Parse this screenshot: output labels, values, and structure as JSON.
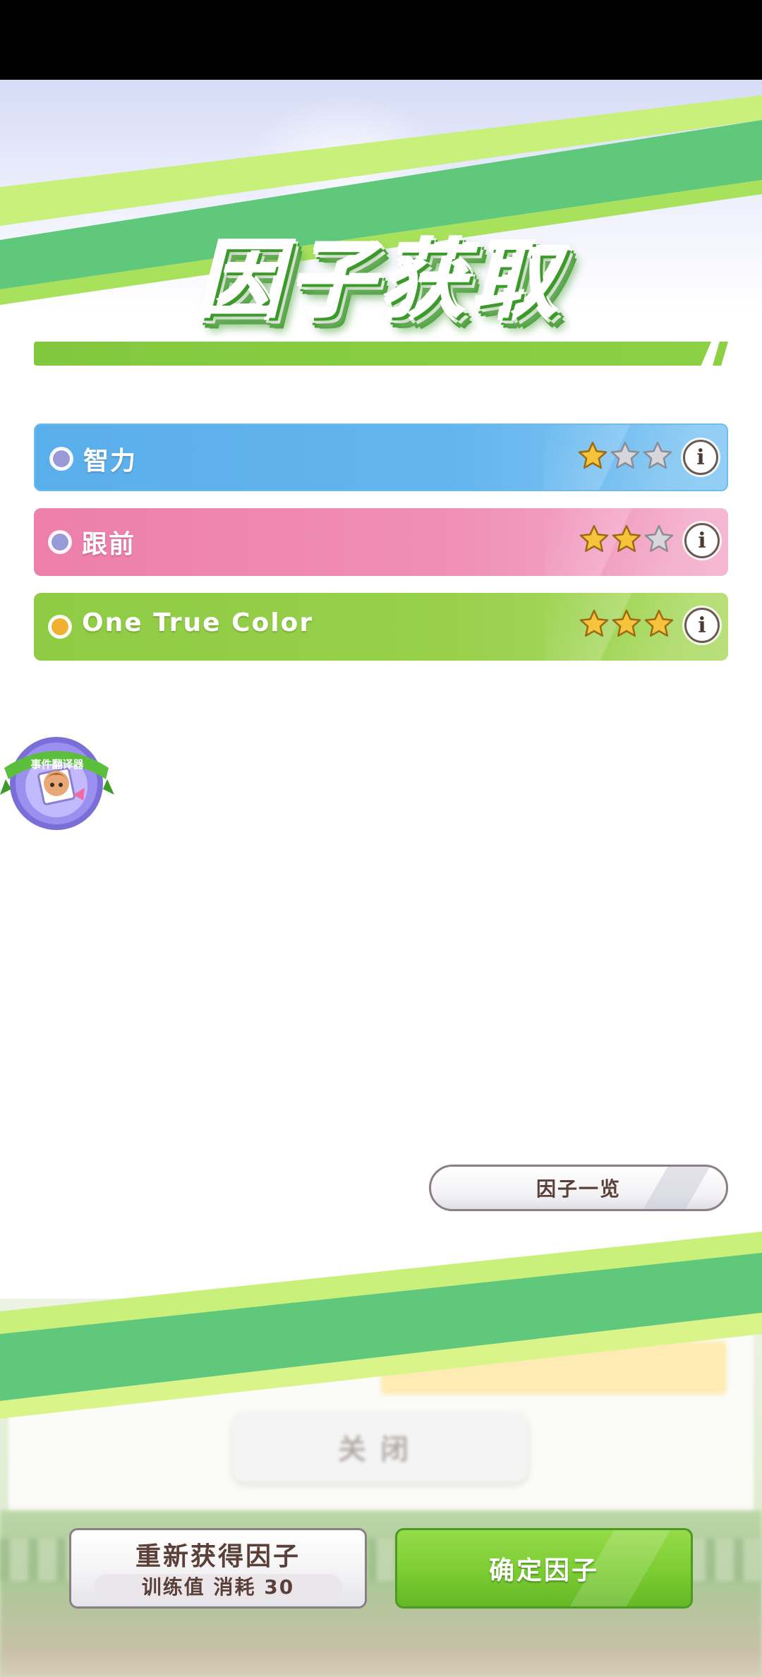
{
  "title": "因子获取",
  "factors": [
    {
      "name": "智力",
      "stars": 1,
      "max_stars": 3,
      "color": "#5aaeea",
      "dot_color": "#9a9ad8"
    },
    {
      "name": "跟前",
      "stars": 2,
      "max_stars": 3,
      "color": "#ee7eac",
      "dot_color": "#9a9ad8"
    },
    {
      "name": "One True Color",
      "stars": 3,
      "max_stars": 3,
      "color": "#8fcb44",
      "dot_color": "#f0b030"
    }
  ],
  "info_icon_label": "i",
  "badge": {
    "label": "事件翻译器"
  },
  "list_button": {
    "label": "因子一览"
  },
  "background": {
    "ghost_button_label": "关闭"
  },
  "reget_button": {
    "label": "重新获得因子",
    "cost_label": "训练值 消耗 30"
  },
  "confirm_button": {
    "label": "确定因子"
  },
  "colors": {
    "accent_green": "#8cd044",
    "stripe_green": "#5fc87a",
    "stripe_lime": "#c8f07a",
    "star_gold": "#f6c33a",
    "star_gray": "#d6d6dc"
  }
}
